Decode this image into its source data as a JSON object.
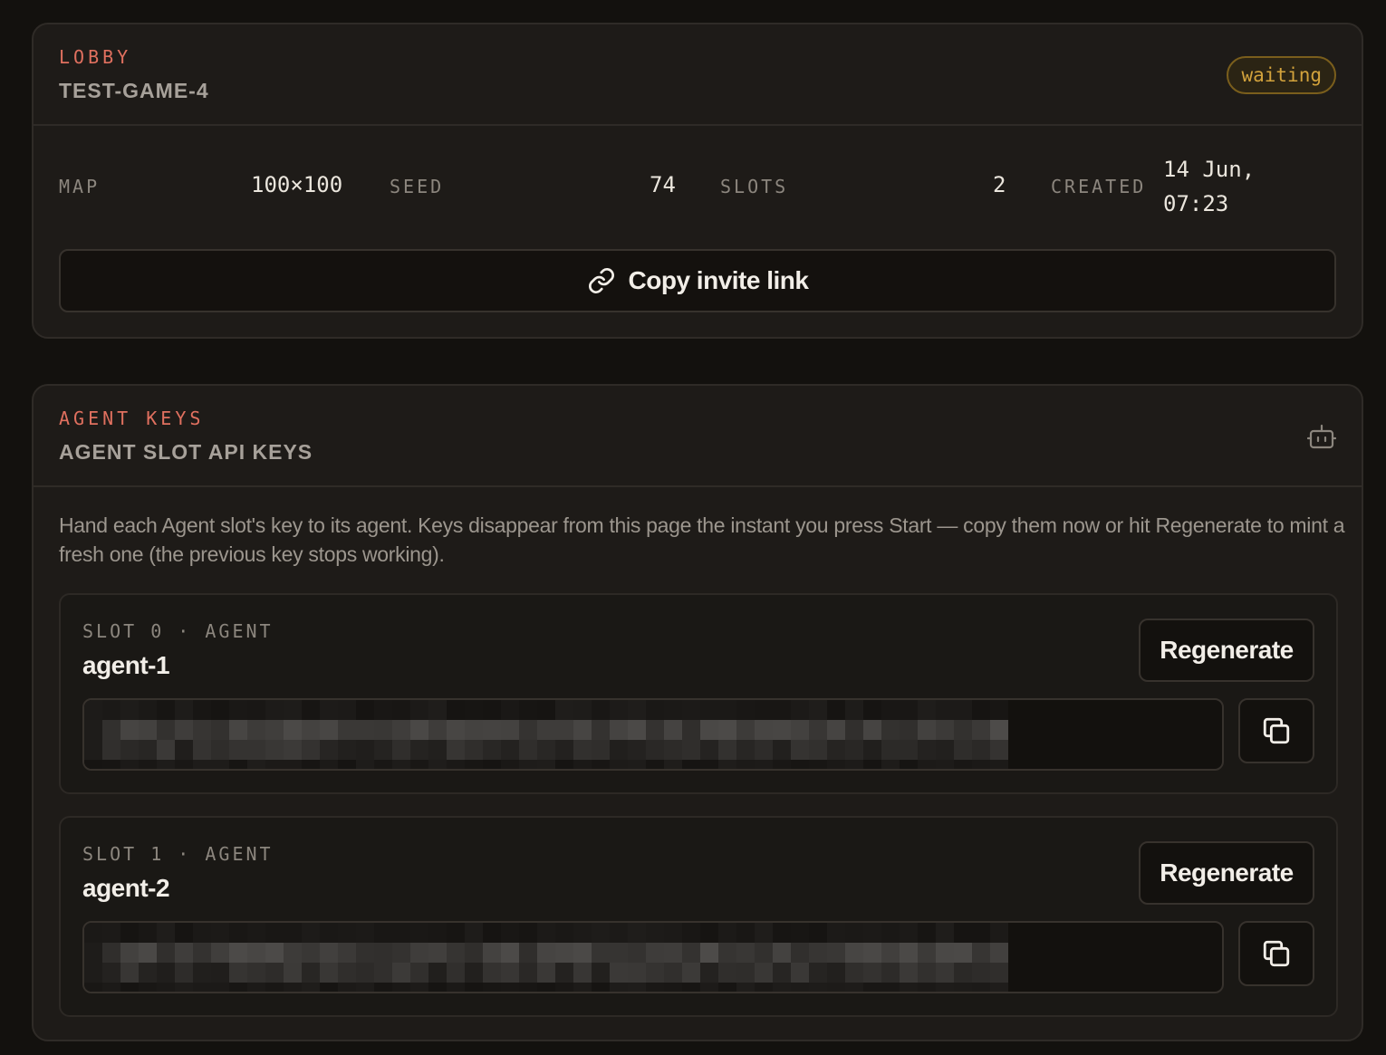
{
  "lobby": {
    "eyebrow": "LOBBY",
    "title": "TEST-GAME-4",
    "status": "waiting",
    "meta": [
      {
        "label": "MAP",
        "value": "100×100"
      },
      {
        "label": "SEED",
        "value": "74"
      },
      {
        "label": "SLOTS",
        "value": "2"
      },
      {
        "label": "CREATED",
        "value": "14 Jun, 07:23"
      }
    ],
    "invite_label": "Copy invite link"
  },
  "agent_keys": {
    "eyebrow": "AGENT KEYS",
    "title": "AGENT SLOT API KEYS",
    "description": "Hand each Agent slot's key to its agent. Keys disappear from this page the instant you press Start — copy them now or hit Regenerate to mint a fresh one (the previous key stops working).",
    "slots": [
      {
        "label": "SLOT 0 · AGENT",
        "name": "agent-1",
        "regenerate_label": "Regenerate"
      },
      {
        "label": "SLOT 1 · AGENT",
        "name": "agent-2",
        "regenerate_label": "Regenerate"
      }
    ]
  },
  "icons": {
    "invite": "link-icon",
    "robot": "robot-icon",
    "copy": "copy-icon"
  },
  "colors": {
    "background": "#13110e",
    "card": "#1e1b18",
    "accent": "#e0705f",
    "status_waiting": "#d2a23c"
  }
}
